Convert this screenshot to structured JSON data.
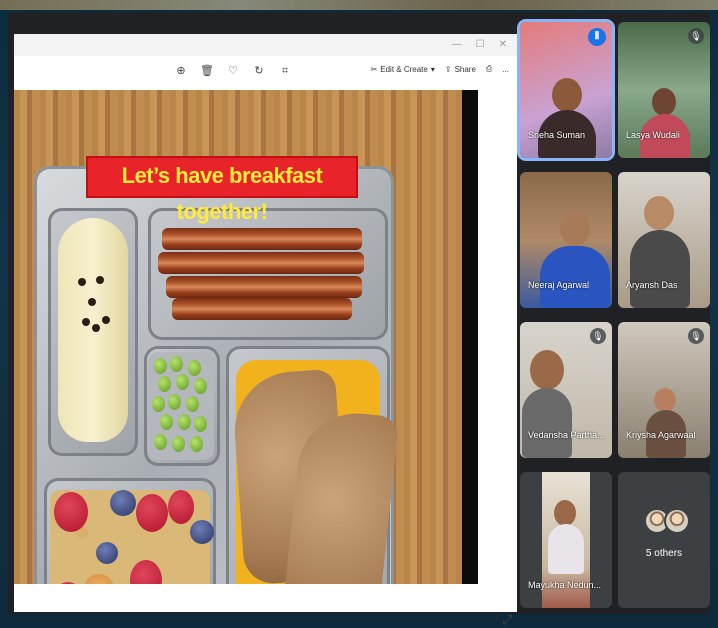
{
  "slide": {
    "banner_text": "Let’s have breakfast together!"
  },
  "viewer_toolbar": {
    "icons": [
      "zoom-in-icon",
      "delete-icon",
      "heart-icon",
      "rotate-icon",
      "crop-icon"
    ],
    "edit_create_label": "Edit & Create",
    "share_label": "Share",
    "more_label": "..."
  },
  "participants": [
    {
      "name": "Sneha Suman",
      "status": "speaking"
    },
    {
      "name": "Lasya Wudali",
      "status": "muted"
    },
    {
      "name": "Neeraj Agarwal",
      "status": "none"
    },
    {
      "name": "Aryansh Das",
      "status": "none"
    },
    {
      "name": "Vedansha Partha...",
      "status": "muted"
    },
    {
      "name": "Kriysha Agarwaal",
      "status": "muted"
    },
    {
      "name": "Mayukha Nedun...",
      "status": "none"
    }
  ],
  "others": {
    "label": "5 others"
  },
  "colors": {
    "accent": "#8ab4f8",
    "speaking": "#1a73e8",
    "banner_bg": "#e8232a",
    "banner_text": "#ffeb3b"
  }
}
